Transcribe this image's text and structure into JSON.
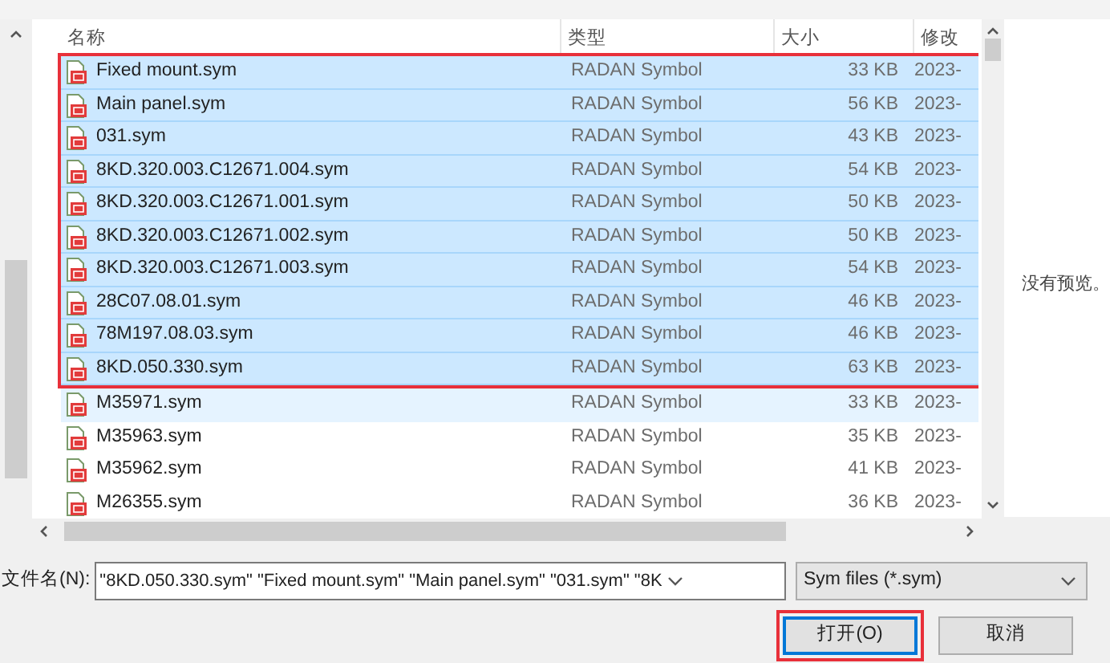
{
  "file_list": {
    "columns": [
      "名称",
      "类型",
      "大小",
      "修改"
    ],
    "rows": [
      {
        "name": "Fixed mount.sym",
        "type": "RADAN Symbol",
        "size": "33 KB",
        "modified": "2023-",
        "selected": true,
        "hovered": false,
        "boxed": true
      },
      {
        "name": "Main panel.sym",
        "type": "RADAN Symbol",
        "size": "56 KB",
        "modified": "2023-",
        "selected": true,
        "hovered": false,
        "boxed": true
      },
      {
        "name": "031.sym",
        "type": "RADAN Symbol",
        "size": "43 KB",
        "modified": "2023-",
        "selected": true,
        "hovered": false,
        "boxed": true
      },
      {
        "name": "8KD.320.003.C12671.004.sym",
        "type": "RADAN Symbol",
        "size": "54 KB",
        "modified": "2023-",
        "selected": true,
        "hovered": false,
        "boxed": true
      },
      {
        "name": "8KD.320.003.C12671.001.sym",
        "type": "RADAN Symbol",
        "size": "50 KB",
        "modified": "2023-",
        "selected": true,
        "hovered": false,
        "boxed": true
      },
      {
        "name": "8KD.320.003.C12671.002.sym",
        "type": "RADAN Symbol",
        "size": "50 KB",
        "modified": "2023-",
        "selected": true,
        "hovered": false,
        "boxed": true
      },
      {
        "name": "8KD.320.003.C12671.003.sym",
        "type": "RADAN Symbol",
        "size": "54 KB",
        "modified": "2023-",
        "selected": true,
        "hovered": false,
        "boxed": true
      },
      {
        "name": "28C07.08.01.sym",
        "type": "RADAN Symbol",
        "size": "46 KB",
        "modified": "2023-",
        "selected": true,
        "hovered": false,
        "boxed": true
      },
      {
        "name": "78M197.08.03.sym",
        "type": "RADAN Symbol",
        "size": "46 KB",
        "modified": "2023-",
        "selected": true,
        "hovered": false,
        "boxed": true
      },
      {
        "name": "8KD.050.330.sym",
        "type": "RADAN Symbol",
        "size": "63 KB",
        "modified": "2023-",
        "selected": true,
        "hovered": false,
        "boxed": true
      },
      {
        "name": "M35971.sym",
        "type": "RADAN Symbol",
        "size": "33 KB",
        "modified": "2023-",
        "selected": false,
        "hovered": true,
        "boxed": false
      },
      {
        "name": "M35963.sym",
        "type": "RADAN Symbol",
        "size": "35 KB",
        "modified": "2023-",
        "selected": false,
        "hovered": false,
        "boxed": false
      },
      {
        "name": "M35962.sym",
        "type": "RADAN Symbol",
        "size": "41 KB",
        "modified": "2023-",
        "selected": false,
        "hovered": false,
        "boxed": false
      },
      {
        "name": "M26355.sym",
        "type": "RADAN Symbol",
        "size": "36 KB",
        "modified": "2023-",
        "selected": false,
        "hovered": false,
        "boxed": false
      }
    ]
  },
  "preview": {
    "message": "没有预览。"
  },
  "file_name": {
    "label": "文件名(N):",
    "value": "\"8KD.050.330.sym\" \"Fixed mount.sym\" \"Main panel.sym\" \"031.sym\" \"8K"
  },
  "file_type": {
    "value": "Sym files (*.sym)"
  },
  "buttons": [
    {
      "label": "打开(O)",
      "default": true,
      "boxed": true
    },
    {
      "label": "取消",
      "default": false,
      "boxed": false
    }
  ]
}
